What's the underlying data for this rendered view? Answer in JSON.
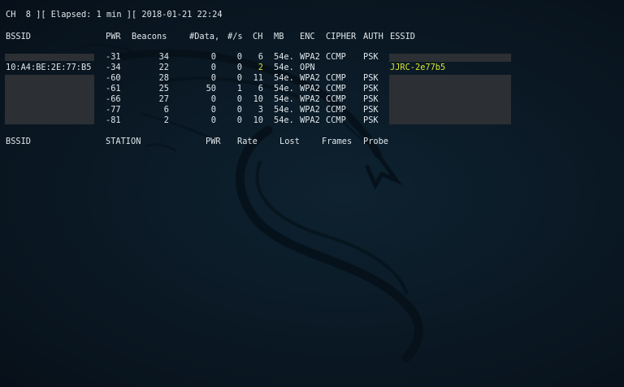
{
  "status_line": "CH  8 ][ Elapsed: 1 min ][ 2018-01-21 22:24",
  "ap_headers": {
    "bssid": "BSSID",
    "pwr": "PWR",
    "beacons": "Beacons",
    "data": "#Data,",
    "rate": "#/s",
    "ch": "CH",
    "mb": "MB",
    "enc": "ENC",
    "cipher": "CIPHER",
    "auth": "AUTH",
    "essid": "ESSID"
  },
  "ap_rows": [
    {
      "bssid": "",
      "pwr": "-31",
      "beacons": "34",
      "data": "0",
      "rate": "0",
      "ch": "6",
      "mb": "54e.",
      "enc": "WPA2",
      "cipher": "CCMP",
      "auth": "PSK",
      "essid": ""
    },
    {
      "bssid": "10:A4:BE:2E:77:B5",
      "pwr": "-34",
      "beacons": "22",
      "data": "0",
      "rate": "0",
      "ch": "2",
      "mb": "54e.",
      "enc": "OPN",
      "cipher": "",
      "auth": "",
      "essid": "JJRC-2e77b5"
    },
    {
      "bssid": "",
      "pwr": "-60",
      "beacons": "28",
      "data": "0",
      "rate": "0",
      "ch": "11",
      "mb": "54e.",
      "enc": "WPA2",
      "cipher": "CCMP",
      "auth": "PSK",
      "essid": ""
    },
    {
      "bssid": "",
      "pwr": "-61",
      "beacons": "25",
      "data": "50",
      "rate": "1",
      "ch": "6",
      "mb": "54e.",
      "enc": "WPA2",
      "cipher": "CCMP",
      "auth": "PSK",
      "essid": ""
    },
    {
      "bssid": "",
      "pwr": "-66",
      "beacons": "27",
      "data": "0",
      "rate": "0",
      "ch": "10",
      "mb": "54e.",
      "enc": "WPA2",
      "cipher": "CCMP",
      "auth": "PSK",
      "essid": ""
    },
    {
      "bssid": "",
      "pwr": "-77",
      "beacons": "6",
      "data": "0",
      "rate": "0",
      "ch": "3",
      "mb": "54e.",
      "enc": "WPA2",
      "cipher": "CCMP",
      "auth": "PSK",
      "essid": ""
    },
    {
      "bssid": "",
      "pwr": "-81",
      "beacons": "2",
      "data": "0",
      "rate": "0",
      "ch": "10",
      "mb": "54e.",
      "enc": "WPA2",
      "cipher": "CCMP",
      "auth": "PSK",
      "essid": ""
    }
  ],
  "station_headers": {
    "bssid": "BSSID",
    "station": "STATION",
    "pwr": "PWR",
    "rate": "Rate",
    "lost": "Lost",
    "frames": "Frames",
    "probe": "Probe"
  },
  "colors": {
    "background": "#0b1a26",
    "text": "#dfe6ea",
    "highlight": "#d8e62a",
    "redaction": "#2c2f33"
  },
  "icons": [
    "kali-dragon-wallpaper-icon"
  ]
}
